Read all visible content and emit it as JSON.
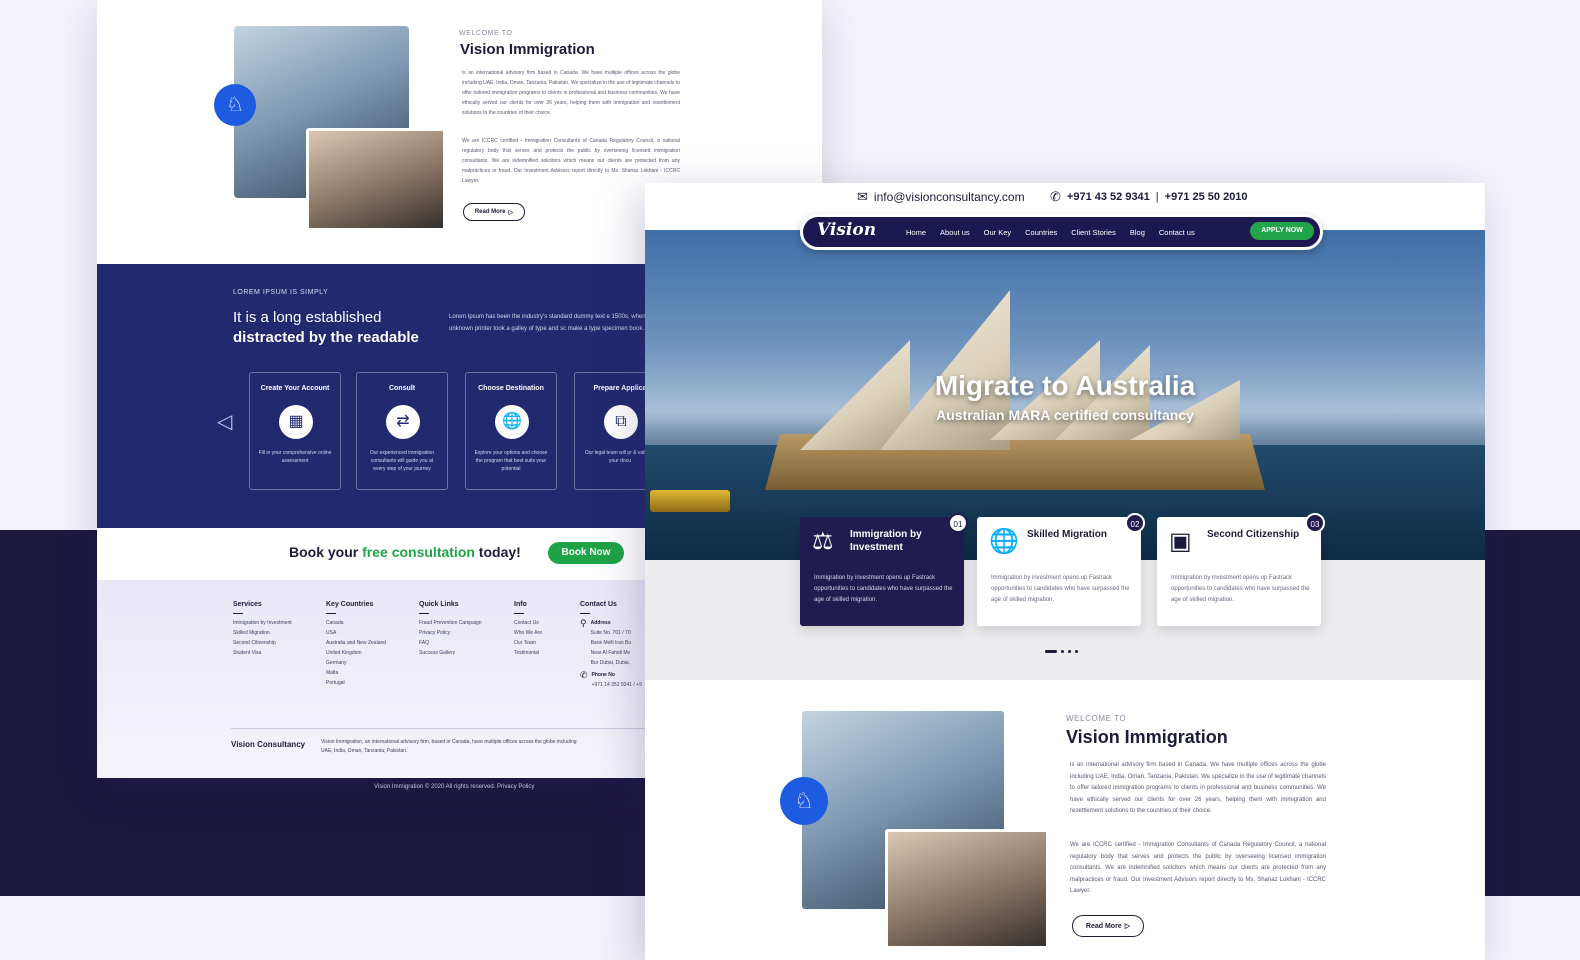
{
  "about": {
    "kicker": "WELCOME TO",
    "title": "Vision Immigration",
    "para1": "is an international advisory firm based in Canada. We have multiple offices across the globe including UAE, India, Oman, Tanzania, Pakistan. We specialize in the use of legitimate channels to offer tailored immigration programs to clients in professional and business communities. We have ethically served our clients for over 26 years, helping them with immigration and resettlement solutions to the countries of their choice.",
    "para2": "We are ICCRC certified - Immigration Consultants of Canada Regulatory Council, a national regulatory body that serves and protects the public by overseeing licensed immigration consultants. We are indemnified solicitors which means our clients are protected from any malpractices or fraud. Our Investment Advisors report directly to Ms. Shanaz Lokhani - ICCRC Lawyer.",
    "read_more": "Read More"
  },
  "steps_section": {
    "kicker": "LOREM IPSUM IS SIMPLY",
    "heading_light": "It is a long established",
    "heading_bold": "distracted by the readable",
    "lorem": "Lorem Ipsum has been the industry's standard dummy text e 1500s, when an unknown printer took a galley of type and sc make a type specimen book.",
    "cards": [
      {
        "title": "Create Your Account",
        "desc": "Fill in your comprehensive online assessment",
        "icon": "id-card-icon"
      },
      {
        "title": "Consult",
        "desc": "Our experienced immigration consultants will guide you at every step of your journey",
        "icon": "consult-icon"
      },
      {
        "title": "Choose Destination",
        "desc": "Explore your options and choose the program that best suits your potential",
        "icon": "globe-icon"
      },
      {
        "title": "Prepare Applica",
        "desc": "Our legal team will pr & validate your docu",
        "icon": "documents-icon"
      }
    ]
  },
  "book": {
    "pre": "Book your ",
    "highlight": "free consultation",
    "post": " today!",
    "button": "Book Now"
  },
  "footer": {
    "columns": [
      {
        "heading": "Services",
        "links": [
          "Immigration by Investment",
          "Skilled Migration",
          "Second Citizenship",
          "Student Visa"
        ]
      },
      {
        "heading": "Key Countries",
        "links": [
          "Canada",
          "USA",
          "Australia and New Zealand",
          "United Kingdom",
          "Germany",
          "Malta",
          "Portugal"
        ]
      },
      {
        "heading": "Quick Links",
        "links": [
          "Fraud Prevention Campaign",
          "Privacy Policy",
          "FAQ",
          "Success Gallery"
        ]
      },
      {
        "heading": "Info",
        "links": [
          "Contact Us",
          "Who We Are",
          "Our Team",
          "Testimonial"
        ]
      }
    ],
    "contact_heading": "Contact Us",
    "address_label": "Address",
    "address_lines": [
      "Suite No. 701 / 70",
      "Bank Melli Iran Bu",
      "Near Al Fahidi Me",
      "Bur Dubai, Dubai,"
    ],
    "phone_label": "Phone No",
    "phone_value": "+971 14 352 9341 / +9",
    "brand": "Vision Consultancy",
    "brand_desc": "Vision Immigration, an international advisory firm, based in Canada, have multiple offices across the globe including UAE, India, Oman, Tanzania, Pakistan.",
    "copyright": "Vision Immigration © 2020 All rights reserved. Privacy Policy"
  },
  "topbar": {
    "email": "info@visionconsultancy.com",
    "phone1": "+971 43 52 9341",
    "separator": "|",
    "phone2": "+971 25 50 2010"
  },
  "nav": {
    "logo": "Vision",
    "items": [
      "Home",
      "About us",
      "Our Key",
      "Countries",
      "Client Stories",
      "Blog",
      "Contact us"
    ],
    "apply": "APPLY NOW"
  },
  "hero": {
    "headline": "Migrate to Australia",
    "subheadline": "Australian MARA certified consultancy"
  },
  "services": [
    {
      "num": "01",
      "title": "Immigration by Investment",
      "desc": "Immigration by investment opens up Fastrack opportunities to candidates who have surpassed the age of skilled migration.",
      "icon": "investment-icon"
    },
    {
      "num": "02",
      "title": "Skilled Migration",
      "desc": "Immigration by investment opens up Fastrack opportunities to candidates who have surpassed the age of skilled migration.",
      "icon": "globe-hand-icon"
    },
    {
      "num": "03",
      "title": "Second Citizenship",
      "desc": "Immigration by investment opens up Fastrack opportunities to candidates who have surpassed the age of skilled migration.",
      "icon": "passport-icon"
    }
  ],
  "colors": {
    "navy": "#212a6f",
    "dark": "#1c1840",
    "green": "#1fa347",
    "blue": "#1d5be0"
  }
}
